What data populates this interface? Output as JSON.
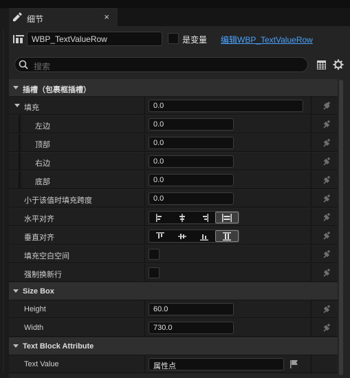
{
  "tab": {
    "title": "细节",
    "close_glyph": "×",
    "icon": "details-icon"
  },
  "header": {
    "widget_name": "WBP_TextValueRow",
    "is_variable_label": "是变量",
    "is_variable_checked": false,
    "edit_link": "编辑WBP_TextValueRow"
  },
  "search": {
    "placeholder": "搜索"
  },
  "sections": {
    "slot": {
      "title": "插槽（包裹框插槽）",
      "padding_label": "填充",
      "padding_value": "0.0",
      "left_label": "左边",
      "left_value": "0.0",
      "top_label": "顶部",
      "top_value": "0.0",
      "right_label": "右边",
      "right_value": "0.0",
      "bottom_label": "底部",
      "bottom_value": "0.0",
      "fill_span_label": "小于该值时填充跨度",
      "fill_span_value": "0.0",
      "h_align_label": "水平对齐",
      "v_align_label": "垂直对齐",
      "fill_empty_label": "填充空白空间",
      "fill_empty_checked": false,
      "force_newline_label": "强制换新行",
      "force_newline_checked": false
    },
    "size_box": {
      "title": "Size Box",
      "height_label": "Height",
      "height_value": "60.0",
      "width_label": "Width",
      "width_value": "730.0"
    },
    "text_block": {
      "title": "Text Block Attribute",
      "text_value_label": "Text Value",
      "text_value": "属性点"
    }
  },
  "colors": {
    "link": "#4aa3ff",
    "panel": "#242424",
    "input": "#0f0f0f"
  }
}
